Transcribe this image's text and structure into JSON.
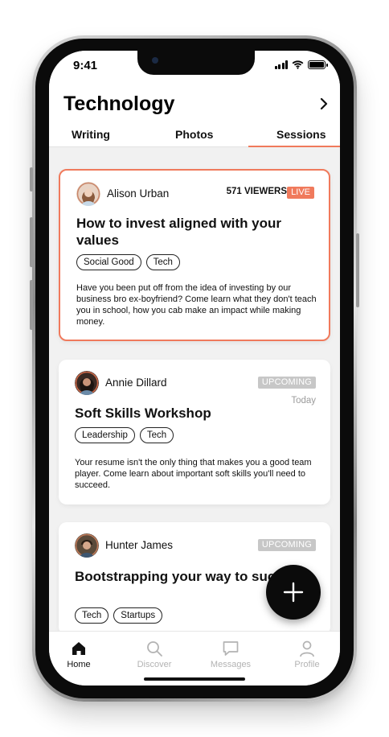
{
  "status_bar": {
    "time": "9:41"
  },
  "header": {
    "title": "Technology"
  },
  "tabs": [
    {
      "label": "Writing"
    },
    {
      "label": "Photos"
    },
    {
      "label": "Sessions",
      "active": true
    }
  ],
  "colors": {
    "accent": "#f07a5c",
    "badge_upcoming": "#c7c7c7",
    "fab": "#0b0b0b"
  },
  "sessions": [
    {
      "author": "Alison Urban",
      "viewers": "571 VIEWERS",
      "badge": "LIVE",
      "title": "How to invest aligned with your values",
      "tags": [
        "Social Good",
        "Tech"
      ],
      "description": "Have you been put off from the idea of investing by our business bro ex-boyfriend? Come learn what they don't teach you in school, how you cab make an impact while making money."
    },
    {
      "author": "Annie Dillard",
      "badge": "UPCOMING",
      "when": "Today",
      "title": "Soft Skills Workshop",
      "tags": [
        "Leadership",
        "Tech"
      ],
      "description": "Your resume isn't the only thing that makes you a good team player. Come learn about important soft skills you'll need to succeed."
    },
    {
      "author": "Hunter James",
      "badge": "UPCOMING",
      "title": "Bootstrapping your way to success",
      "tags": [
        "Tech",
        "Startups"
      ]
    }
  ],
  "fab": {
    "icon": "plus-icon"
  },
  "bottom_nav": [
    {
      "label": "Home",
      "icon": "home-icon",
      "active": true
    },
    {
      "label": "Discover",
      "icon": "search-icon"
    },
    {
      "label": "Messages",
      "icon": "chat-bubble-icon"
    },
    {
      "label": "Profile",
      "icon": "person-icon"
    }
  ]
}
